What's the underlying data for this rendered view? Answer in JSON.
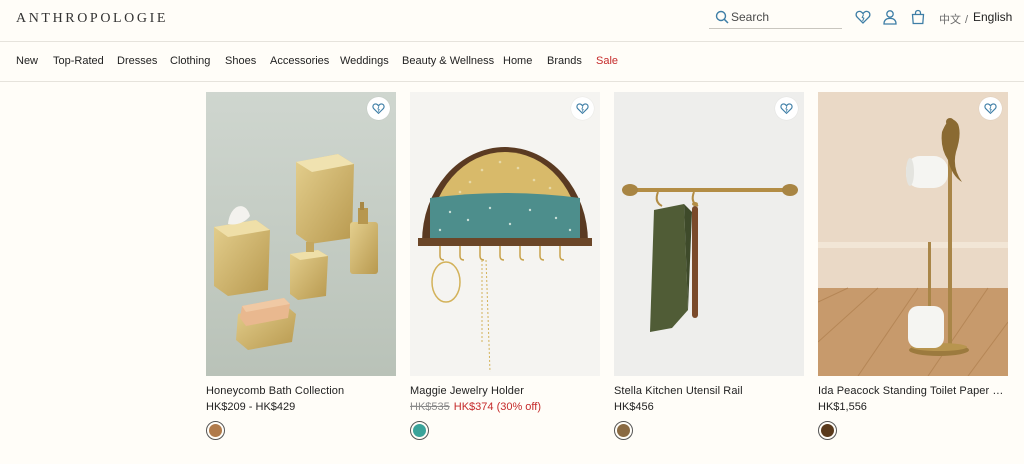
{
  "header": {
    "logo": "ANTHROPOLOGIE",
    "search_placeholder": "Search",
    "icons": [
      "search-icon",
      "heart-icon",
      "user-icon",
      "bag-icon"
    ],
    "language": {
      "chinese": "中文",
      "separator": "/",
      "english": "English"
    }
  },
  "nav": {
    "items": [
      "New",
      "Top-Rated",
      "Dresses",
      "Clothing",
      "Shoes",
      "Accessories",
      "Weddings",
      "Beauty & Wellness",
      "Home",
      "Brands",
      "Sale"
    ]
  },
  "colors": {
    "accent_blue": "#3e7ea6",
    "sale_red": "#c52a2a",
    "background": "#fffdf8"
  },
  "products": [
    {
      "name": "Honeycomb Bath Collection",
      "price": "HK$209 - HK$429",
      "swatch_color": "#b07a4a"
    },
    {
      "name": "Maggie Jewelry Holder",
      "original_price": "HK$535",
      "sale_price": "HK$374 (30% off)",
      "swatch_color": "#3aa39a"
    },
    {
      "name": "Stella Kitchen Utensil Rail",
      "price": "HK$456",
      "swatch_color": "#8a6a42"
    },
    {
      "name": "Ida Peacock Standing Toilet Paper Holder",
      "price": "HK$1,556",
      "swatch_color": "#5a3a1c"
    }
  ]
}
